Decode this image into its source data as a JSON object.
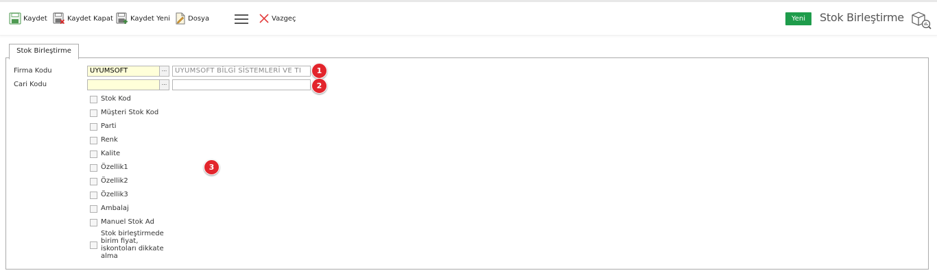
{
  "toolbar": {
    "save_label": "Kaydet",
    "save_close_label": "Kaydet Kapat",
    "save_new_label": "Kaydet Yeni",
    "file_label": "Dosya",
    "cancel_label": "Vazgeç",
    "status_badge": "Yeni",
    "page_title": "Stok Birleştirme"
  },
  "tab": {
    "label": "Stok Birleştirme"
  },
  "form": {
    "firma_kodu_label": "Firma Kodu",
    "firma_kodu_value": "UYUMSOFT",
    "firma_adi_value": "UYUMSOFT BİLGİ SİSTEMLERİ VE TI",
    "cari_kodu_label": "Cari Kodu",
    "cari_kodu_value": "",
    "cari_adi_value": "",
    "lookup_button": "...",
    "options": [
      "Stok Kod",
      "Müşteri Stok Kod",
      "Parti",
      "Renk",
      "Kalite",
      "Özellik1",
      "Özellik2",
      "Özellik3",
      "Ambalaj",
      "Manuel Stok Ad",
      "Stok birleştirmede birim fiyat, iskontoları dikkate alma"
    ]
  },
  "markers": [
    "1",
    "2",
    "3"
  ],
  "colors": {
    "status_badge": "#1e9c4b",
    "marker": "#e2252c",
    "required_field": "#ffffd9"
  }
}
